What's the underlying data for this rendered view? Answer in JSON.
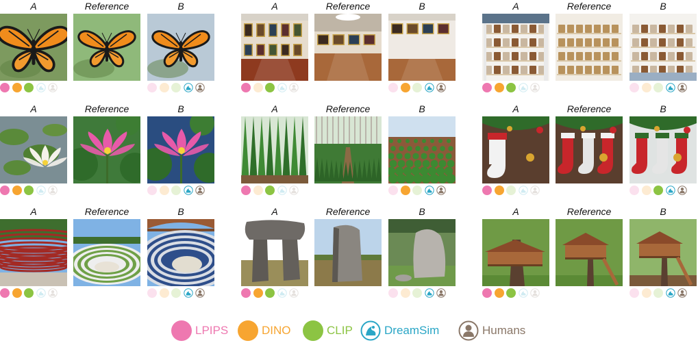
{
  "column_labels": {
    "a": "A",
    "reference": "Reference",
    "b": "B"
  },
  "colors": {
    "lpips": "#ee78b0",
    "dino": "#f7a531",
    "clip": "#8cc443",
    "dreamsim": "#2aa6c6",
    "humans": "#8a7768"
  },
  "triplets": [
    {
      "scene": "monarch butterfly",
      "votes": {
        "lpips": "A",
        "dino": "A",
        "clip": "A",
        "dreamsim": "B",
        "humans": "B"
      }
    },
    {
      "scene": "art gallery",
      "votes": {
        "lpips": "A",
        "dino": "B",
        "clip": "A",
        "dreamsim": "B",
        "humans": "B"
      }
    },
    {
      "scene": "pantry shelves",
      "votes": {
        "lpips": "A",
        "dino": "A",
        "clip": "A",
        "dreamsim": "B",
        "humans": "B"
      }
    },
    {
      "scene": "lotus flower",
      "votes": {
        "lpips": "A",
        "dino": "A",
        "clip": "A",
        "dreamsim": "B",
        "humans": "B"
      }
    },
    {
      "scene": "tree plantation",
      "votes": {
        "lpips": "A",
        "dino": "B",
        "clip": "A",
        "dreamsim": "B",
        "humans": "B"
      }
    },
    {
      "scene": "christmas stockings",
      "votes": {
        "lpips": "A",
        "dino": "A",
        "clip": "B",
        "dreamsim": "B",
        "humans": "B"
      }
    },
    {
      "scene": "amphitheater",
      "votes": {
        "lpips": "A",
        "dino": "A",
        "clip": "A",
        "dreamsim": "B",
        "humans": "B"
      }
    },
    {
      "scene": "standing stone",
      "votes": {
        "lpips": "A",
        "dino": "A",
        "clip": "A",
        "dreamsim": "B",
        "humans": "B"
      }
    },
    {
      "scene": "treehouse",
      "votes": {
        "lpips": "A",
        "dino": "A",
        "clip": "A",
        "dreamsim": "B",
        "humans": "B"
      }
    }
  ],
  "legend": [
    {
      "key": "lpips",
      "label": "LPIPS",
      "icon": "filled-circle"
    },
    {
      "key": "dino",
      "label": "DINO",
      "icon": "filled-circle"
    },
    {
      "key": "clip",
      "label": "CLIP",
      "icon": "filled-circle"
    },
    {
      "key": "dreamsim",
      "label": "DreamSim",
      "icon": "dreamsim-icon"
    },
    {
      "key": "humans",
      "label": "Humans",
      "icon": "person-icon"
    }
  ]
}
